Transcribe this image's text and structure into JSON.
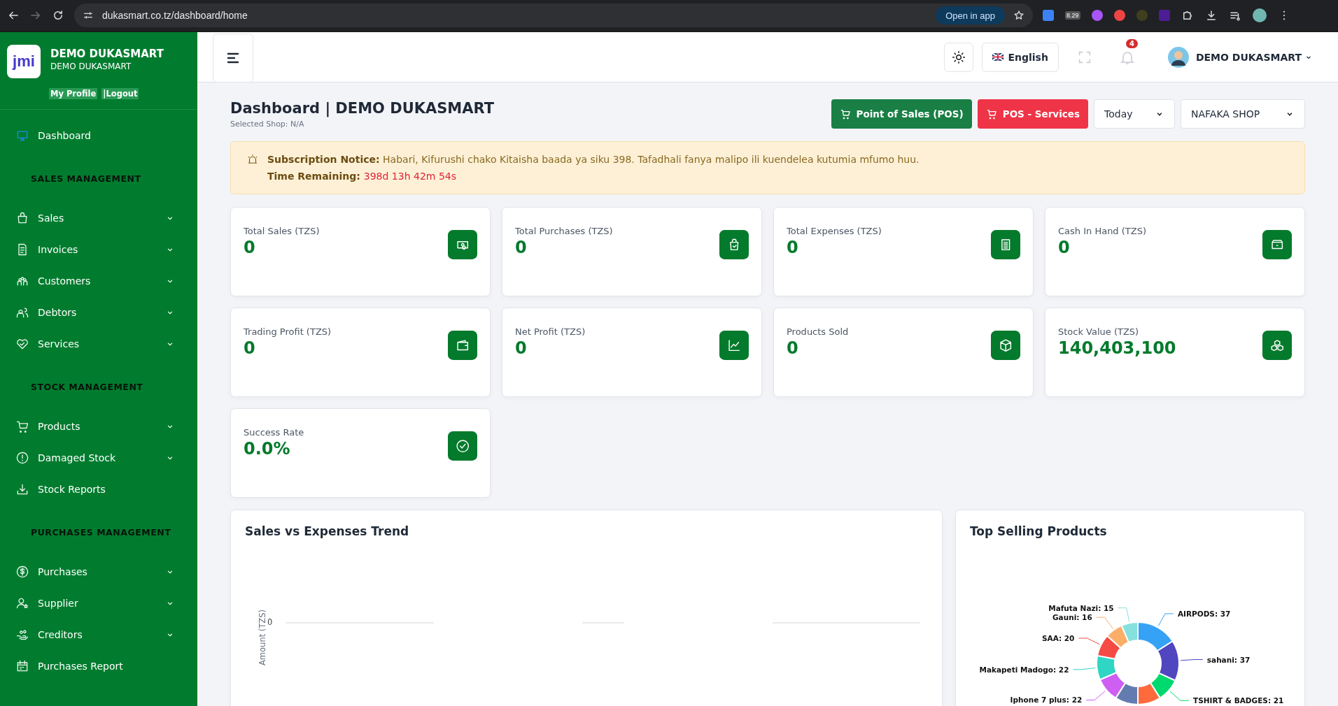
{
  "browser": {
    "url": "dukasmart.co.tz/dashboard/home",
    "open_in_app": "Open in app",
    "extension_badge": "8.29"
  },
  "sidebar": {
    "logo": "jmi",
    "name": "DEMO DUKASMART",
    "subtitle": "DEMO DUKASMART",
    "links": [
      "My Profile",
      "|Logout"
    ],
    "items": [
      {
        "kind": "link",
        "label": "Dashboard",
        "selected": true,
        "expandable": false
      },
      {
        "kind": "section",
        "label": "SALES MANAGEMENT"
      },
      {
        "kind": "link",
        "label": "Sales",
        "selected": false,
        "expandable": true
      },
      {
        "kind": "link",
        "label": "Invoices",
        "selected": false,
        "expandable": true
      },
      {
        "kind": "link",
        "label": "Customers",
        "selected": false,
        "expandable": true
      },
      {
        "kind": "link",
        "label": "Debtors",
        "selected": false,
        "expandable": true
      },
      {
        "kind": "link",
        "label": "Services",
        "selected": false,
        "expandable": true
      },
      {
        "kind": "section",
        "label": "STOCK MANAGEMENT"
      },
      {
        "kind": "link",
        "label": "Products",
        "selected": false,
        "expandable": true
      },
      {
        "kind": "link",
        "label": "Damaged Stock",
        "selected": false,
        "expandable": true
      },
      {
        "kind": "link",
        "label": "Stock Reports",
        "selected": false,
        "expandable": false
      },
      {
        "kind": "section",
        "label": "PURCHASES MANAGEMENT"
      },
      {
        "kind": "link",
        "label": "Purchases",
        "selected": false,
        "expandable": true
      },
      {
        "kind": "link",
        "label": "Supplier",
        "selected": false,
        "expandable": true
      },
      {
        "kind": "link",
        "label": "Creditors",
        "selected": false,
        "expandable": true
      },
      {
        "kind": "link",
        "label": "Purchases Report",
        "selected": false,
        "expandable": false
      }
    ]
  },
  "header": {
    "language": "English",
    "notifications": "4",
    "user": "DEMO DUKASMART"
  },
  "page": {
    "title": "Dashboard | DEMO DUKASMART",
    "subtitle": "Selected Shop: N/A",
    "actions": [
      {
        "kind": "primary",
        "label": "Point of Sales (POS)"
      },
      {
        "kind": "danger",
        "label": "POS - Services"
      }
    ],
    "filters": [
      {
        "value": "Today"
      },
      {
        "value": "NAFAKA SHOP"
      }
    ]
  },
  "notice": {
    "message": "**Subscription Notice:** Habari, Kifurushi chako Kitaisha baada ya siku 398. Tafadhali fanya malipo ili kuendelea kutumia mfumo huu.",
    "time_label": "Time Remaining:",
    "time_value": "398d 13h 42m 54s"
  },
  "stats": [
    {
      "label": "Total Sales (TZS)",
      "value": "0"
    },
    {
      "label": "Total Purchases (TZS)",
      "value": "0"
    },
    {
      "label": "Total Expenses (TZS)",
      "value": "0"
    },
    {
      "label": "Cash In Hand (TZS)",
      "value": "0"
    },
    {
      "label": "Trading Profit (TZS)",
      "value": "0"
    },
    {
      "label": "Net Profit (TZS)",
      "value": "0"
    },
    {
      "label": "Products Sold",
      "value": "0"
    },
    {
      "label": "Stock Value (TZS)",
      "value": "140,403,100"
    },
    {
      "label": "Success Rate",
      "value": "0.0%"
    }
  ],
  "trend": {
    "title": "Sales vs Expenses Trend",
    "axis_title": "Amount (TZS)",
    "axis_value": "0"
  },
  "top_products": {
    "title": "Top Selling Products",
    "chart_data": {
      "type": "donut",
      "categories": [
        "AIRPODS: 37",
        "sahani: 37",
        "TSHIRT & BADGES: 21",
        null,
        null,
        "Iphone 7 plus: 22",
        "Makapeti Madogo: 22",
        "SAA: 20",
        "Gauni: 16",
        "Mafuta Nazi: 15"
      ],
      "values": [
        37,
        37,
        21,
        21,
        21,
        22,
        22,
        20,
        16,
        15
      ],
      "colors": [
        "#36a2f5",
        "#4f46c0",
        "#00d96d",
        "#ff6a3d",
        "#637cb0",
        "#cf5ff3",
        "#2fd6c3",
        "#f54b45",
        "#fbae68",
        "#86e0dd"
      ]
    }
  }
}
